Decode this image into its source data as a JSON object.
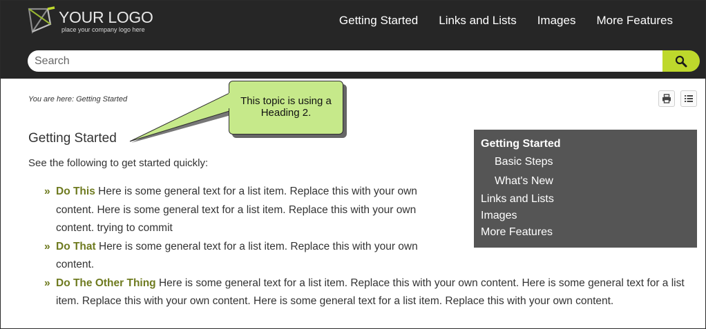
{
  "header": {
    "logo_text": "YOUR LOGO",
    "logo_tagline": "place your company logo here",
    "nav": [
      "Getting Started",
      "Links and Lists",
      "Images",
      "More Features"
    ]
  },
  "search": {
    "placeholder": "Search"
  },
  "breadcrumb": "You are here: Getting Started",
  "callout": {
    "line1": "This topic is using a",
    "line2": "Heading 2."
  },
  "page": {
    "title": "Getting Started",
    "intro": "See the following to get started quickly:",
    "bullet_glyph": "»",
    "items": [
      {
        "title": "Do This",
        "text": " Here is some general text for a list item. Replace this with your own content. Here is some general text for a list item. Replace this with your own content. trying to commit"
      },
      {
        "title": "Do That",
        "text": " Here is some general text for a list item. Replace this with your own content."
      },
      {
        "title": "Do The Other Thing",
        "text": " Here is some general text for a list item. Replace this with your own content. Here is some general text for a list item. Replace this with your own content. Here is some general text for a list item. Replace this with your own content."
      }
    ]
  },
  "mini_toc": {
    "items": [
      "Getting Started",
      "Basic Steps",
      "What's New",
      "Links and Lists",
      "Images",
      "More Features"
    ]
  },
  "colors": {
    "header_bg": "#262626",
    "accent_green": "#bed82c",
    "link_olive": "#6e7a1f",
    "callout_bg": "#c6e98a",
    "toc_bg": "#555555"
  },
  "icons": [
    "logo-mark-icon",
    "search-icon",
    "print-icon",
    "toc-list-icon"
  ]
}
